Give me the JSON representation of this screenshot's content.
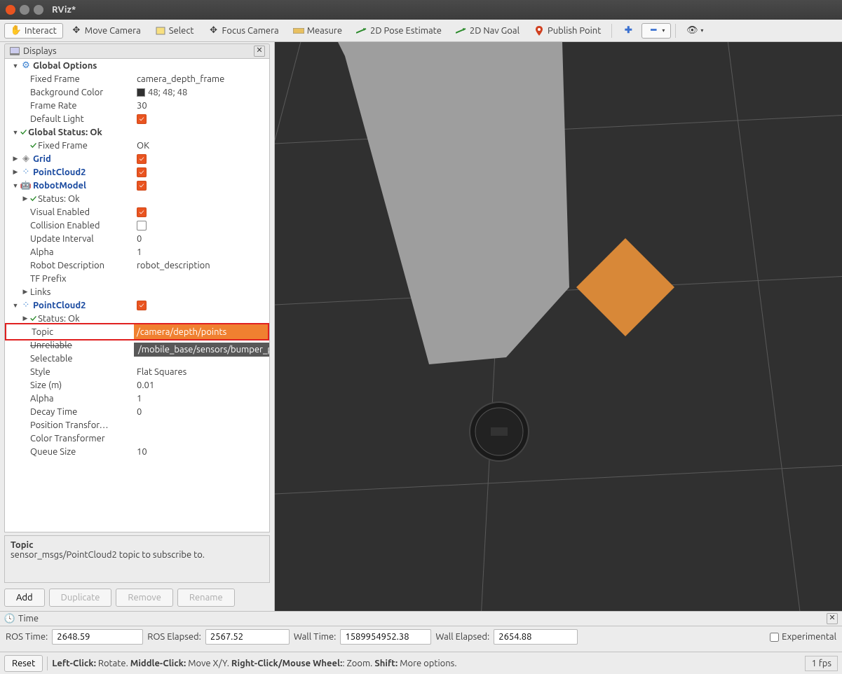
{
  "window": {
    "title": "RViz*"
  },
  "toolbar": {
    "interact": "Interact",
    "move_camera": "Move Camera",
    "select": "Select",
    "focus_camera": "Focus Camera",
    "measure": "Measure",
    "pose_estimate": "2D Pose Estimate",
    "nav_goal": "2D Nav Goal",
    "publish_point": "Publish Point"
  },
  "displays": {
    "title": "Displays",
    "global_options": {
      "label": "Global Options",
      "fixed_frame": {
        "label": "Fixed Frame",
        "value": "camera_depth_frame"
      },
      "background_color": {
        "label": "Background Color",
        "value": "48; 48; 48"
      },
      "frame_rate": {
        "label": "Frame Rate",
        "value": "30"
      },
      "default_light": {
        "label": "Default Light"
      }
    },
    "global_status": {
      "label": "Global Status: Ok",
      "fixed_frame": {
        "label": "Fixed Frame",
        "value": "OK"
      }
    },
    "grid": {
      "label": "Grid"
    },
    "pointcloud2_a": {
      "label": "PointCloud2"
    },
    "robotmodel": {
      "label": "RobotModel",
      "status": {
        "label": "Status: Ok"
      },
      "visual_enabled": {
        "label": "Visual Enabled"
      },
      "collision_enabled": {
        "label": "Collision Enabled"
      },
      "update_interval": {
        "label": "Update Interval",
        "value": "0"
      },
      "alpha": {
        "label": "Alpha",
        "value": "1"
      },
      "robot_description": {
        "label": "Robot Description",
        "value": "robot_description"
      },
      "tf_prefix": {
        "label": "TF Prefix"
      },
      "links": {
        "label": "Links"
      }
    },
    "pointcloud2_b": {
      "label": "PointCloud2",
      "status": {
        "label": "Status: Ok"
      },
      "topic": {
        "label": "Topic",
        "value": "/camera/depth/points",
        "dropdown": "/mobile_base/sensors/bumper_pointcloud"
      },
      "unreliable": {
        "label": "Unreliable"
      },
      "selectable": {
        "label": "Selectable"
      },
      "style": {
        "label": "Style",
        "value": "Flat Squares"
      },
      "size": {
        "label": "Size (m)",
        "value": "0.01"
      },
      "alpha": {
        "label": "Alpha",
        "value": "1"
      },
      "decay_time": {
        "label": "Decay Time",
        "value": "0"
      },
      "position_transformer": {
        "label": "Position Transfor…"
      },
      "color_transformer": {
        "label": "Color Transformer"
      },
      "queue_size": {
        "label": "Queue Size",
        "value": "10"
      }
    }
  },
  "description": {
    "title": "Topic",
    "text": "sensor_msgs/PointCloud2 topic to subscribe to."
  },
  "buttons": {
    "add": "Add",
    "duplicate": "Duplicate",
    "remove": "Remove",
    "rename": "Rename"
  },
  "time": {
    "title": "Time",
    "ros_time": {
      "label": "ROS Time:",
      "value": "2648.59"
    },
    "ros_elapsed": {
      "label": "ROS Elapsed:",
      "value": "2567.52"
    },
    "wall_time": {
      "label": "Wall Time:",
      "value": "1589954952.38"
    },
    "wall_elapsed": {
      "label": "Wall Elapsed:",
      "value": "2654.88"
    },
    "experimental": "Experimental"
  },
  "status": {
    "reset": "Reset",
    "hint_parts": {
      "p1": "Left-Click:",
      "p1v": " Rotate. ",
      "p2": "Middle-Click:",
      "p2v": " Move X/Y. ",
      "p3": "Right-Click/Mouse Wheel:",
      "p3v": ": Zoom. ",
      "p4": "Shift:",
      "p4v": " More options."
    },
    "fps": "1 fps"
  }
}
